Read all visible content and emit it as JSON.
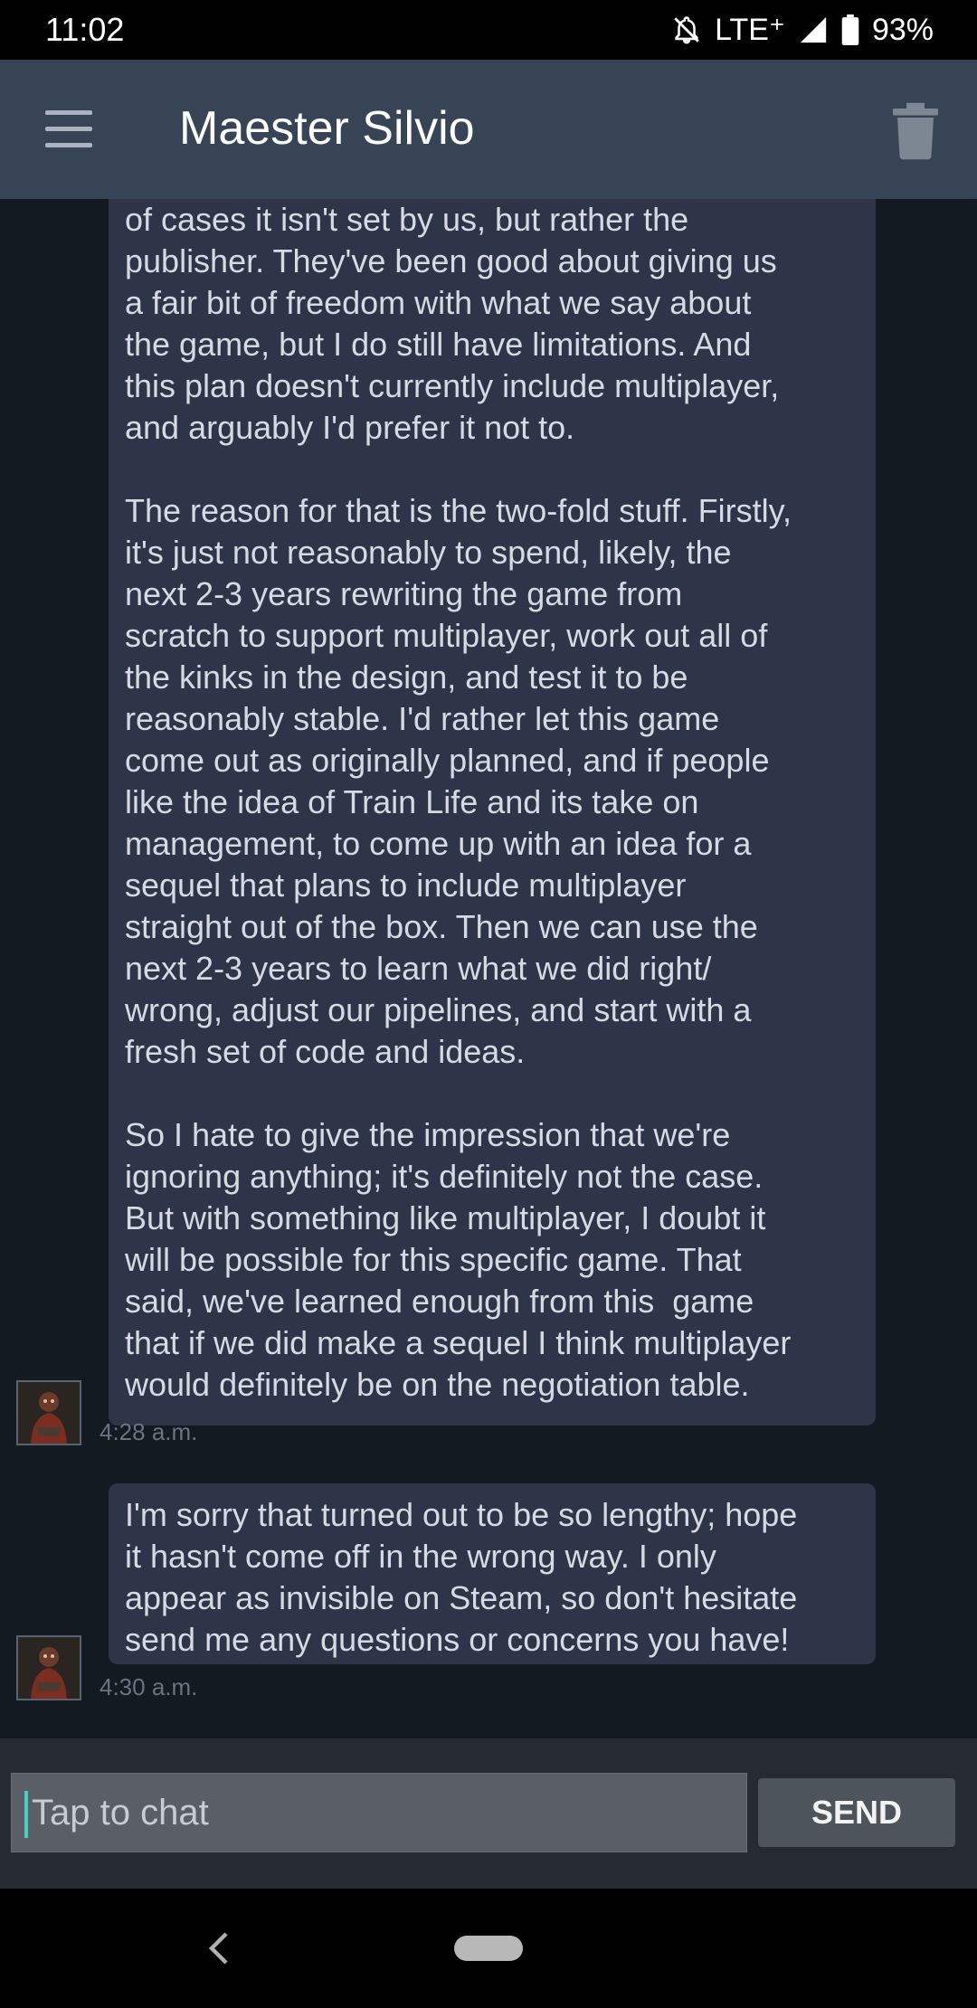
{
  "status_bar": {
    "time": "11:02",
    "network": "LTE⁺",
    "battery": "93%",
    "icons": [
      "notifications-off-icon",
      "signal-icon",
      "battery-icon"
    ]
  },
  "header": {
    "title": "Maester Silvio",
    "menu_icon": "hamburger-menu-icon",
    "delete_icon": "trash-icon"
  },
  "messages": [
    {
      "text": "of cases it isn't set by us, but rather the\npublisher. They've been good about giving us\na fair bit of freedom with what we say about\nthe game, but I do still have limitations. And\nthis plan doesn't currently include multiplayer,\nand arguably I'd prefer it not to.\n\nThe reason for that is the two-fold stuff. Firstly,\nit's just not reasonably to spend, likely, the\nnext 2-3 years rewriting the game from\nscratch to support multiplayer, work out all of\nthe kinks in the design, and test it to be\nreasonably stable. I'd rather let this game\ncome out as originally planned, and if people\nlike the idea of Train Life and its take on\nmanagement, to come up with an idea for a\nsequel that plans to include multiplayer\nstraight out of the box. Then we can use the\nnext 2-3 years to learn what we did right/\nwrong, adjust our pipelines, and start with a\nfresh set of code and ideas.\n\nSo I hate to give the impression that we're\nignoring anything; it's definitely not the case.\nBut with something like multiplayer, I doubt it\nwill be possible for this specific game. That\nsaid, we've learned enough from this  game\nthat if we did make a sequel I think multiplayer\nwould definitely be on the negotiation table.",
      "time": "4:28 a.m."
    },
    {
      "text": "I'm sorry that turned out to be so lengthy; hope\nit hasn't come off in the wrong way. I only\nappear as invisible on Steam, so don't hesitate\nsend me any questions or concerns you have!",
      "time": "4:30 a.m."
    }
  ],
  "composer": {
    "placeholder": "Tap to chat",
    "send_label": "SEND"
  },
  "nav": {
    "back_icon": "back-chevron-icon",
    "home_icon": "home-pill-icon"
  },
  "colors": {
    "header_bg": "#374456",
    "chat_bg": "#141a22",
    "bubble_bg": "#2e3548",
    "accent_cursor": "#45d0c8"
  }
}
